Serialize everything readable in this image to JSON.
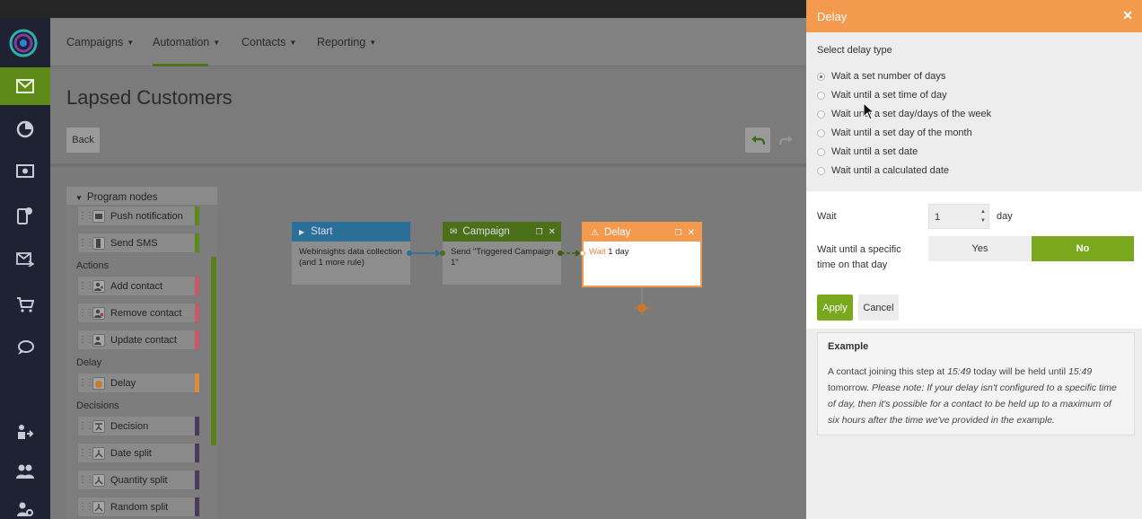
{
  "sidebar": {
    "items": [
      {
        "icon": "email-icon",
        "active": true
      },
      {
        "icon": "pie-chart-icon"
      },
      {
        "icon": "monitor-icon"
      },
      {
        "icon": "mobile-icon"
      },
      {
        "icon": "email-send-icon"
      },
      {
        "icon": "cart-icon"
      },
      {
        "icon": "chat-icon"
      },
      {
        "icon": "import-icon"
      },
      {
        "icon": "users-icon"
      },
      {
        "icon": "user-settings-icon"
      }
    ]
  },
  "nav": {
    "items": [
      {
        "label": "Campaigns"
      },
      {
        "label": "Automation"
      },
      {
        "label": "Contacts"
      },
      {
        "label": "Reporting"
      }
    ],
    "active": "Automation"
  },
  "page": {
    "title": "Lapsed Customers",
    "back_label": "Back"
  },
  "palette": {
    "header": "Program nodes",
    "sections": {
      "actions": "Actions",
      "delay": "Delay",
      "decisions": "Decisions"
    },
    "nodes": [
      {
        "label": "Push notification",
        "color": "#5a8a1c"
      },
      {
        "label": "Send SMS",
        "color": "#5a8a1c"
      },
      {
        "label": "Add contact",
        "color": "#c9586a"
      },
      {
        "label": "Remove contact",
        "color": "#c9586a"
      },
      {
        "label": "Update contact",
        "color": "#c9586a"
      },
      {
        "label": "Delay",
        "color": "#e08a3e"
      },
      {
        "label": "Decision",
        "color": "#4d3a5a"
      },
      {
        "label": "Date split",
        "color": "#4d3a5a"
      },
      {
        "label": "Quantity split",
        "color": "#4d3a5a"
      },
      {
        "label": "Random split",
        "color": "#4d3a5a"
      }
    ]
  },
  "flow": {
    "start": {
      "title": "Start",
      "body": "Webinsights data collection (and 1 more rule)",
      "color": "#2a8fc4"
    },
    "campaign": {
      "title": "Campaign",
      "body": "Send \"Triggered Campaign 1\"",
      "color": "#5a8a1c"
    },
    "delay": {
      "title": "Delay",
      "wait_word": "Wait",
      "wait_value": "1 day",
      "color": "#f39a4e"
    }
  },
  "dialog": {
    "title": "Delay",
    "select_label": "Select delay type",
    "options": [
      {
        "label": "Wait a set number of days",
        "selected": true
      },
      {
        "label": "Wait until a set time of day"
      },
      {
        "label": "Wait until a set day/days of the week"
      },
      {
        "label": "Wait until a set day of the month"
      },
      {
        "label": "Wait until a set date"
      },
      {
        "label": "Wait until a calculated date"
      }
    ],
    "wait_label": "Wait",
    "wait_value": "1",
    "unit": "day",
    "specific_time_label": "Wait until a specific time on that day",
    "yes_label": "Yes",
    "no_label": "No",
    "toggle_selected": "No",
    "apply_label": "Apply",
    "cancel_label": "Cancel",
    "example": {
      "heading": "Example",
      "text_1": "A contact joining this step at",
      "time_1": "15:49",
      "text_2": "today will be held until",
      "time_2": "15:49",
      "text_3": "tomorrow.",
      "note": "Please note: If your delay isn't configured to a specific time of day, then it's possible for a contact to be held up to a maximum of six hours after the time we've provided in the example."
    }
  },
  "colors": {
    "accent_green": "#79a81c",
    "dialog_header": "#f39a4e",
    "sidebar_bg": "#1e2233"
  }
}
